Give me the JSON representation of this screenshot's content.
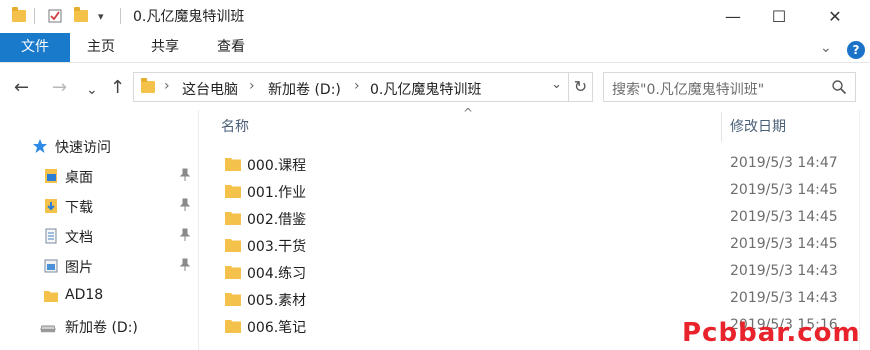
{
  "window": {
    "title": "0.凡亿魔鬼特训班",
    "controls": {
      "minimize": "—",
      "maximize": "☐",
      "close": "✕"
    },
    "qat_dropdown": "▾"
  },
  "ribbon": {
    "tabs": [
      {
        "label": "文件",
        "active": true
      },
      {
        "label": "主页"
      },
      {
        "label": "共享"
      },
      {
        "label": "查看"
      }
    ],
    "help": "?",
    "collapse": "⌄"
  },
  "nav_buttons": {
    "back": "←",
    "forward": "→",
    "recent": "⌄",
    "up": "↑"
  },
  "address": {
    "segments": [
      "这台电脑",
      "新加卷 (D:)",
      "0.凡亿魔鬼特训班"
    ],
    "separator": "›",
    "dropdown": "⌄",
    "refresh": "↻"
  },
  "search": {
    "placeholder": "搜索\"0.凡亿魔鬼特训班\""
  },
  "navigation": {
    "quick_access": "快速访问",
    "items": [
      {
        "label": "桌面",
        "icon": "desktop-icon",
        "pinned": true
      },
      {
        "label": "下载",
        "icon": "download-icon",
        "pinned": true
      },
      {
        "label": "文档",
        "icon": "documents-icon",
        "pinned": true
      },
      {
        "label": "图片",
        "icon": "pictures-icon",
        "pinned": true
      },
      {
        "label": "AD18",
        "icon": "folder-icon",
        "pinned": false
      },
      {
        "label": "新加卷 (D:)",
        "icon": "drive-icon",
        "pinned": false
      }
    ]
  },
  "file_list": {
    "columns": {
      "name": "名称",
      "modified": "修改日期"
    },
    "sort_indicator": "^",
    "rows": [
      {
        "name": "000.课程",
        "date": "2019/5/3 14:47"
      },
      {
        "name": "001.作业",
        "date": "2019/5/3 14:45"
      },
      {
        "name": "002.借鉴",
        "date": "2019/5/3 14:45"
      },
      {
        "name": "003.干货",
        "date": "2019/5/3 14:45"
      },
      {
        "name": "004.练习",
        "date": "2019/5/3 14:43"
      },
      {
        "name": "005.素材",
        "date": "2019/5/3 14:43"
      },
      {
        "name": "006.笔记",
        "date": "2019/5/3 15:16"
      }
    ]
  },
  "watermark": "Pcbbar.com",
  "colors": {
    "accent": "#1979ca",
    "folder": "#f4c24a",
    "watermark": "#e8232b",
    "header_text": "#4c607a"
  }
}
